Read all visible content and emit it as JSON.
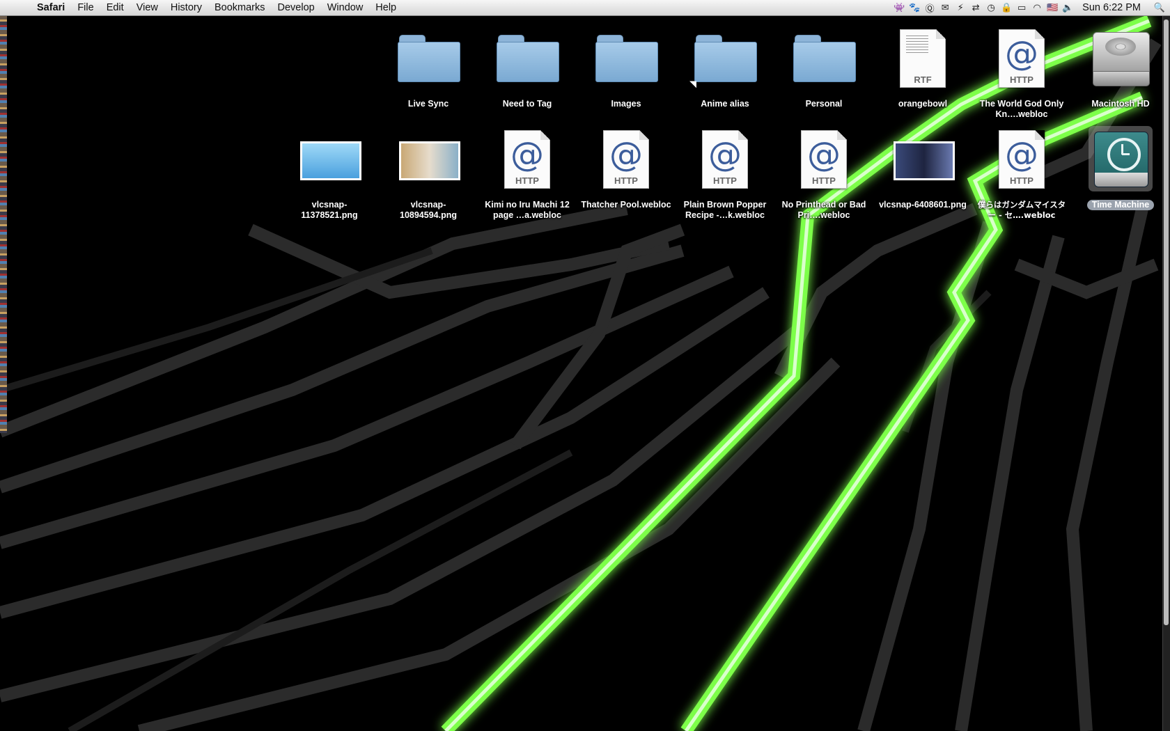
{
  "menubar": {
    "app": "Safari",
    "items": [
      "File",
      "Edit",
      "View",
      "History",
      "Bookmarks",
      "Develop",
      "Window",
      "Help"
    ],
    "clock": "Sun 6:22 PM",
    "status_icons": [
      "alien-icon",
      "growl-icon",
      "quicksilver-icon",
      "mail-icon",
      "dropbox-icon",
      "sync-icon",
      "time-machine-icon",
      "lock-icon",
      "battery-icon",
      "wifi-icon",
      "flag-icon",
      "volume-icon"
    ]
  },
  "desktop": {
    "row1": [
      {
        "label": "Live Sync",
        "kind": "folder"
      },
      {
        "label": "Need to Tag",
        "kind": "folder"
      },
      {
        "label": "Images",
        "kind": "folder"
      },
      {
        "label": "Anime alias",
        "kind": "folder"
      },
      {
        "label": "Personal",
        "kind": "folder"
      },
      {
        "label": "orangebowl",
        "kind": "rtf",
        "tag": "RTF"
      },
      {
        "label": "The World God Only Kn….webloc",
        "kind": "webloc",
        "tag": "HTTP"
      },
      {
        "label": "Macintosh HD",
        "kind": "harddisk"
      }
    ],
    "row2": [
      {
        "label": "vlcsnap-11378521.png",
        "kind": "image"
      },
      {
        "label": "vlcsnap-10894594.png",
        "kind": "image"
      },
      {
        "label": "Kimi no Iru Machi 12 page …a.webloc",
        "kind": "webloc",
        "tag": "HTTP"
      },
      {
        "label": "Thatcher Pool.webloc",
        "kind": "webloc",
        "tag": "HTTP"
      },
      {
        "label": "Plain Brown Popper Recipe -…k.webloc",
        "kind": "webloc",
        "tag": "HTTP"
      },
      {
        "label": "No Printhead or Bad Pri….webloc",
        "kind": "webloc",
        "tag": "HTTP"
      },
      {
        "label": "vlcsnap-6408601.png",
        "kind": "image"
      },
      {
        "label": "僕らはガンダムマイスター - セ….webloc",
        "kind": "webloc",
        "tag": "HTTP"
      },
      {
        "label": "Time Machine",
        "kind": "timemachine"
      }
    ]
  },
  "colors": {
    "accent_green": "#7dff4a",
    "wallpaper": "#000000",
    "stripe": "#2e2e2e"
  }
}
